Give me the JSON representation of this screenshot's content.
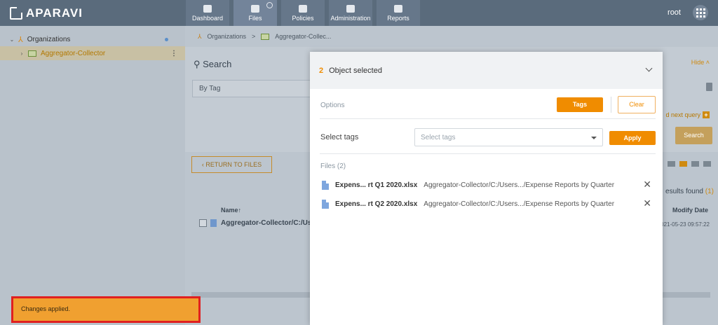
{
  "app": {
    "logo_text": "APARAVI"
  },
  "nav": {
    "items": [
      {
        "label": "Dashboard",
        "icon": "dashboard-icon"
      },
      {
        "label": "Files",
        "icon": "folder-icon"
      },
      {
        "label": "Policies",
        "icon": "gear-icon"
      },
      {
        "label": "Administration",
        "icon": "users-icon"
      },
      {
        "label": "Reports",
        "icon": "clipboard-icon"
      }
    ],
    "user": "root"
  },
  "sidebar": {
    "organizations_label": "Organizations",
    "selected_item": "Aggregator-Collector"
  },
  "breadcrumb": {
    "root": "Organizations",
    "separator": ">",
    "current": "Aggregator-Collec..."
  },
  "search": {
    "title": "Search",
    "by_tag": "By Tag",
    "hide": "Hide",
    "add_next_query": "d next query",
    "search_button": "Search"
  },
  "results": {
    "return_button": "RETURN TO FILES",
    "count_text": "esults found",
    "count": "(1)",
    "col_name": "Name",
    "col_modify": "Modify Date",
    "row_name": "Aggregator-Collector/C:/Use",
    "row_date": "021-05-23 09:57:22"
  },
  "modal": {
    "selected_count": "2",
    "selected_text": "Object selected",
    "options_label": "Options",
    "tags_button": "Tags",
    "clear_button": "Clear",
    "select_tags_label": "Select tags",
    "select_tags_placeholder": "Select tags",
    "apply_button": "Apply",
    "files_label": "Files (2)",
    "files": [
      {
        "name": "Expens... rt Q1 2020.xlsx",
        "path": "Aggregator-Collector/C:/Users.../Expense Reports by Quarter"
      },
      {
        "name": "Expens... rt Q2 2020.xlsx",
        "path": "Aggregator-Collector/C:/Users.../Expense Reports by Quarter"
      }
    ]
  },
  "toast": {
    "message": "Changes applied."
  },
  "colors": {
    "accent": "#f08c00",
    "topbar": "#5a6b7c",
    "toast_border": "#e02020"
  }
}
